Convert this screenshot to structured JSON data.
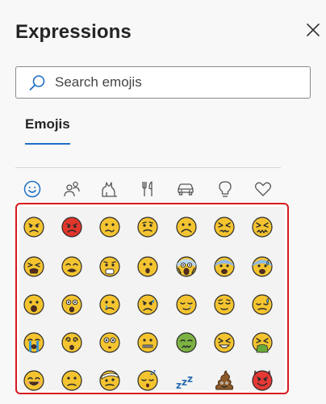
{
  "panel": {
    "title": "Expressions"
  },
  "search": {
    "placeholder": "Search emojis",
    "value": ""
  },
  "tabs": [
    {
      "label": "Emojis",
      "selected": true
    }
  ],
  "categories": [
    {
      "icon": "smiley-face-icon",
      "selected": true
    },
    {
      "icon": "people-icon",
      "selected": false
    },
    {
      "icon": "animal-icon",
      "selected": false
    },
    {
      "icon": "fork-knife-icon",
      "selected": false
    },
    {
      "icon": "car-icon",
      "selected": false
    },
    {
      "icon": "lightbulb-icon",
      "selected": false
    },
    {
      "icon": "heart-icon",
      "selected": false
    }
  ],
  "emojis": [
    [
      "angry-face",
      "pouting-face",
      "confused-face",
      "worried-face",
      "frowning-face",
      "persevering-face",
      "confounded-face"
    ],
    [
      "tired-face",
      "weary-face",
      "anguished-face",
      "hushed-face",
      "screaming-face",
      "fearful-face",
      "anxious-sweat-face"
    ],
    [
      "open-mouth-face",
      "astonished-face",
      "crying-face",
      "sad-sweat-face",
      "sleepy-face",
      "relieved-face",
      "downcast-sweat-face"
    ],
    [
      "loudly-crying-face",
      "dizzy-face",
      "flushed-face",
      "zipper-mouth-face",
      "nauseated-face",
      "squinting-face",
      "vomiting-face"
    ],
    [
      "smiling-closed-eyes-face",
      "slightly-frowning-face",
      "bandaged-face",
      "sleeping-face",
      "zzz",
      "pile-of-poo",
      "smiling-devil"
    ]
  ],
  "colors": {
    "accent": "#1f6fc5",
    "highlight": "#d7191f",
    "emoji_face": "#f4c430",
    "emoji_outline": "#2b2b2b"
  }
}
